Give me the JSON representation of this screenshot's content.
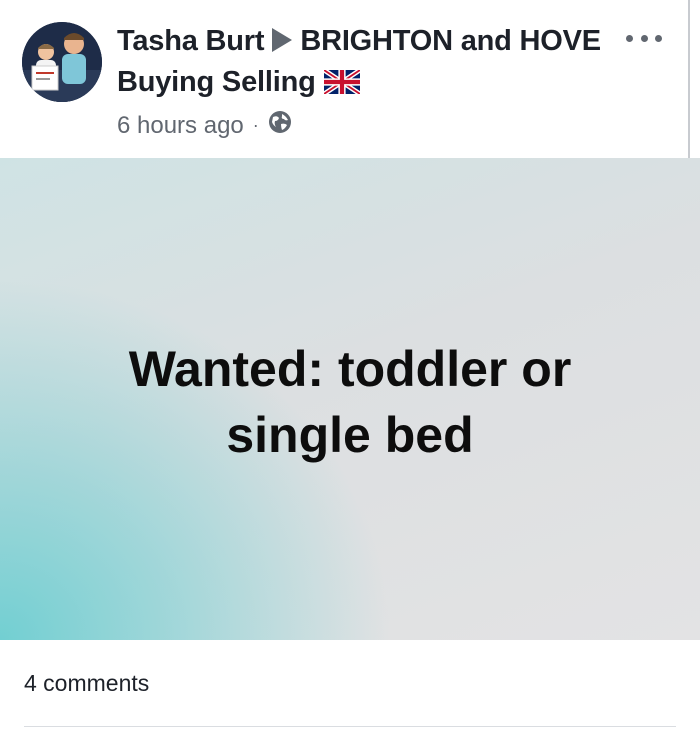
{
  "post": {
    "author_name": "Tasha Burt",
    "group_name": "BRIGHTON and HOVE Buying Selling",
    "timestamp": "6 hours ago",
    "separator": "·",
    "privacy_icon": "globe-icon",
    "flag_icon": "uk-flag-icon",
    "more_icon": "more-options-icon",
    "image_text": "Wanted: toddler or single bed",
    "comments_count": "4 comments"
  },
  "colors": {
    "text_primary": "#1d2129",
    "text_secondary": "#616770",
    "image_teal": "#72cfd2",
    "image_gray": "#e3e3e4"
  }
}
